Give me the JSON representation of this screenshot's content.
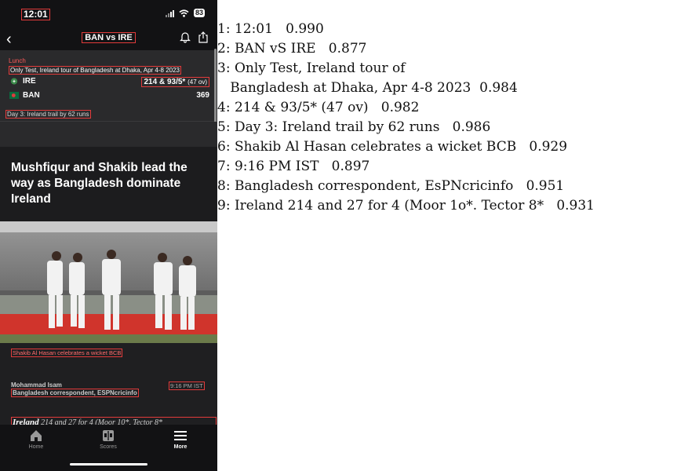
{
  "phone": {
    "status_time": "12:01",
    "battery": "83",
    "nav_title": "BAN vs IRE",
    "match": {
      "status": "Lunch",
      "description": "Only Test, Ireland tour of Bangladesh at Dhaka, Apr 4-8 2023",
      "teams": [
        {
          "name": "IRE",
          "score_main": "214 & 93/5*",
          "score_overs": "(47 ov)"
        },
        {
          "name": "BAN",
          "score_main": "369",
          "score_overs": ""
        }
      ],
      "day_note": "Day 3: Ireland trail by 62 runs"
    },
    "article": {
      "headline": "Mushfiqur and Shakib lead the way as Bangladesh dominate Ireland",
      "photo_caption": "Shakib Al Hasan celebrates a wicket BCB",
      "author": "Mohammad Isam",
      "author_role": "Bangladesh correspondent, ESPNcricinfo",
      "time": "9:16 PM IST",
      "live_line_team": "Ireland",
      "live_line_rest": " 214 and 27 for 4 (Moor 10*, Tector 8*"
    },
    "tabs": [
      {
        "label": "Home",
        "icon": "home-icon"
      },
      {
        "label": "Scores",
        "icon": "scores-icon"
      },
      {
        "label": "More",
        "icon": "menu-icon"
      }
    ]
  },
  "ocr_lines": [
    "1: 12:01   0.990",
    "2: BAN vS IRE   0.877",
    "3: Only Test, Ireland tour of",
    "   Bangladesh at Dhaka, Apr 4-8 2023  0.984",
    "4: 214 & 93/5* (47 ov)   0.982",
    "5: Day 3: Ireland trail by 62 runs   0.986",
    "6: Shakib Al Hasan celebrates a wicket BCB   0.929",
    "7: 9:16 PM IST   0.897",
    "8: Bangladesh correspondent, EsPNcricinfo   0.951",
    "9: Ireland 214 and 27 for 4 (Moor 1o*. Tector 8*   0.931"
  ]
}
